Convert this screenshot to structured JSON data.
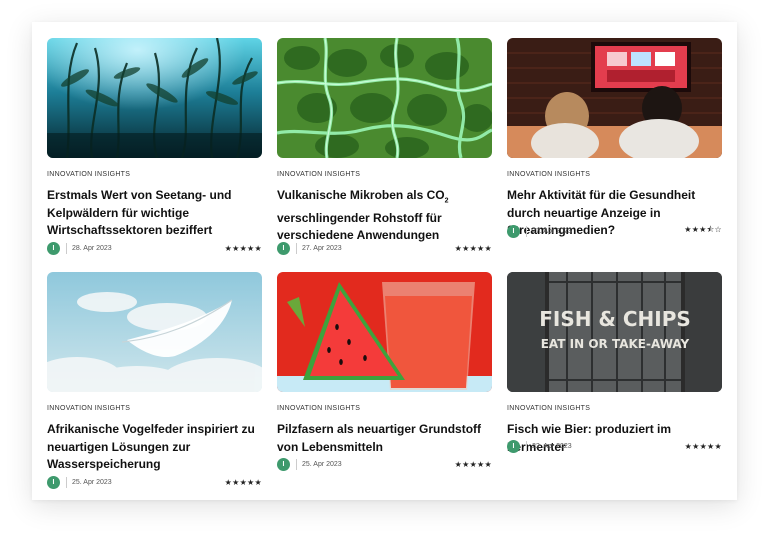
{
  "articles": [
    {
      "category": "INNOVATION INSIGHTS",
      "title": "Erstmals Wert von Seetang- und Kelpwäldern für wichtige Wirtschaftssektoren beziffert",
      "avatar": "I",
      "date": "28. Apr 2023",
      "rating_text": "★★★★★",
      "rating": 5,
      "image": "kelp-forest-underwater-photo"
    },
    {
      "category": "INNOVATION INSIGHTS",
      "title_main": "Vulkanische Mikroben als CO",
      "title_sub": "2",
      "title_rest": " verschlingender Rohstoff für verschiedene Anwendungen",
      "avatar": "I",
      "date": "27. Apr 2023",
      "rating_text": "★★★★★",
      "rating": 5,
      "image": "green-microbe-culture-photo"
    },
    {
      "category": "INNOVATION INSIGHTS",
      "title": "Mehr Aktivität für die Gesundheit durch neuartige Anzeige in Streamingmedien?",
      "avatar": "I",
      "date": "27. Apr 2023",
      "rating_text": "★★★⯪☆",
      "rating": 3.5,
      "image": "couple-watching-tv-photo"
    },
    {
      "category": "INNOVATION INSIGHTS",
      "title": "Afrikanische Vogelfeder inspiriert zu neuartigen Lösungen zur Wasserspeicherung",
      "avatar": "I",
      "date": "25. Apr 2023",
      "rating_text": "★★★★★",
      "rating": 5,
      "image": "feather-in-sky-photo"
    },
    {
      "category": "INNOVATION INSIGHTS",
      "title": "Pilzfasern als neuartiger Grundstoff von Lebensmitteln",
      "avatar": "I",
      "date": "25. Apr 2023",
      "rating_text": "★★★★★",
      "rating": 5,
      "image": "watermelon-juice-photo"
    },
    {
      "category": "INNOVATION INSIGHTS",
      "title": "Fisch wie Bier: produziert im Fermenter",
      "avatar": "I",
      "date": "22. Apr 2023",
      "rating_text": "★★★★★",
      "rating": 5,
      "image": "fish-and-chips-barrel-photo",
      "image_text_1": "FISH & CHIPS",
      "image_text_2": "EAT IN OR TAKE-AWAY"
    }
  ]
}
